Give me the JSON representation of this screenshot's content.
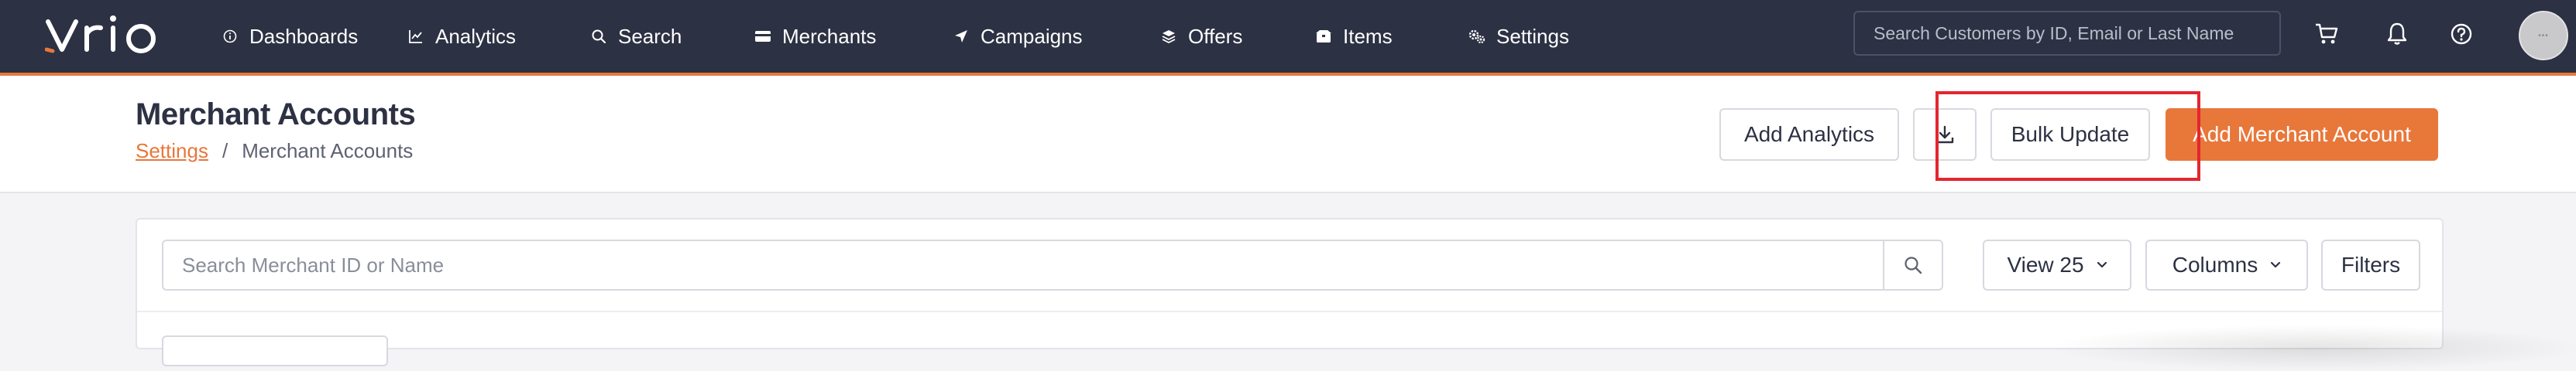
{
  "brand": {
    "logo_text": "vrio",
    "accent": "#e8773a",
    "nav_bg": "#2c3143"
  },
  "nav": {
    "items": [
      {
        "label": "Dashboards",
        "icon": "info-circle-icon"
      },
      {
        "label": "Analytics",
        "icon": "line-chart-icon"
      },
      {
        "label": "Search",
        "icon": "search-icon"
      },
      {
        "label": "Merchants",
        "icon": "credit-card-icon",
        "active": true
      },
      {
        "label": "Campaigns",
        "icon": "send-icon"
      },
      {
        "label": "Offers",
        "icon": "layers-icon"
      },
      {
        "label": "Items",
        "icon": "box-icon"
      },
      {
        "label": "Settings",
        "icon": "gears-icon"
      }
    ],
    "search_placeholder": "Search Customers by ID, Email or Last Name",
    "avatar_text": "•••",
    "right_icons": [
      "cart-icon",
      "bell-icon",
      "help-icon"
    ]
  },
  "header": {
    "title": "Merchant Accounts",
    "breadcrumb": {
      "link": "Settings",
      "separator": "/",
      "current": "Merchant Accounts"
    },
    "buttons": {
      "add_analytics": "Add Analytics",
      "bulk_update": "Bulk Update",
      "add_merchant": "Add Merchant Account"
    },
    "highlight_color": "#e3262f"
  },
  "toolbar": {
    "search_placeholder": "Search Merchant ID or Name",
    "view": "View 25",
    "columns": "Columns",
    "filters": "Filters"
  }
}
